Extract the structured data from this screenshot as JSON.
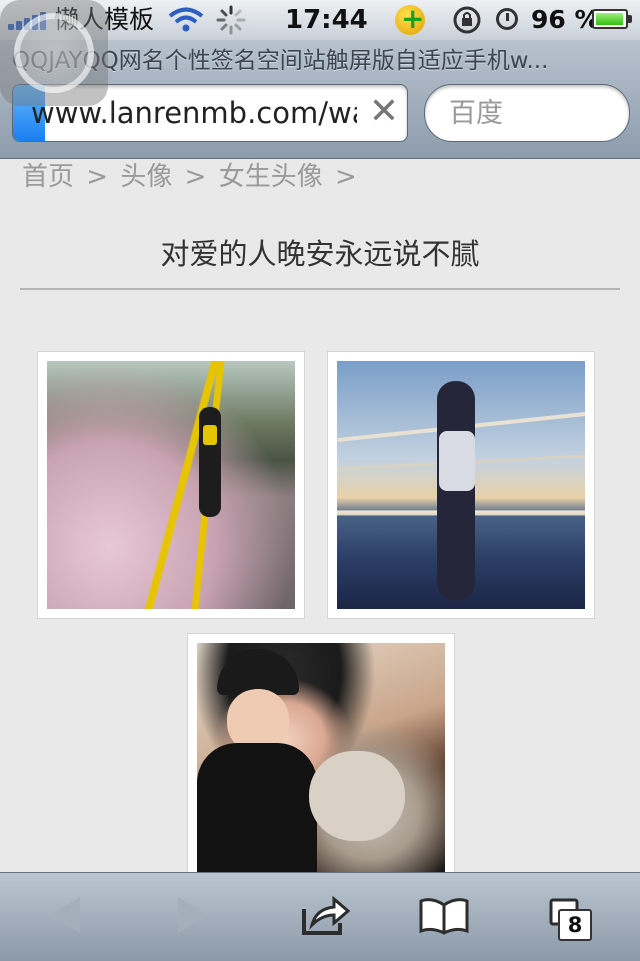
{
  "status_bar": {
    "carrier": "懒人模板",
    "time": "17:44",
    "battery_percent": "96 %",
    "battery_level": 0.96,
    "icons": [
      "signal-icon",
      "wifi-icon",
      "loading-spinner-icon",
      "app-notification-icon",
      "rotation-lock-icon",
      "alarm-icon",
      "battery-icon"
    ]
  },
  "browser": {
    "page_title": "QQJAYQQ网名个性签名空间站触屏版自适应手机w...",
    "url": "www.lanrenmb.com/wap",
    "search_placeholder": "百度",
    "load_progress": 0.08,
    "tabs_count": "8",
    "icons": [
      "assistive-touch-icon",
      "clear-icon",
      "back-arrow-icon",
      "forward-arrow-icon",
      "share-icon",
      "bookmarks-icon",
      "tabs-icon"
    ]
  },
  "breadcrumb": {
    "items": [
      "首页",
      "头像",
      "女生头像"
    ],
    "separator": ">"
  },
  "article": {
    "title": "对爱的人晚安永远说不腻",
    "photos": [
      {
        "description_icon": "photo-girl-walking-road"
      },
      {
        "description_icon": "photo-girl-on-ship"
      },
      {
        "description_icon": "photo-girl-with-dog"
      }
    ]
  },
  "colors": {
    "accent_progress": "#1a7ff0",
    "breadcrumb_text": "#9a9a9a",
    "title_text": "#333333",
    "page_bg": "#e9e9e9"
  }
}
